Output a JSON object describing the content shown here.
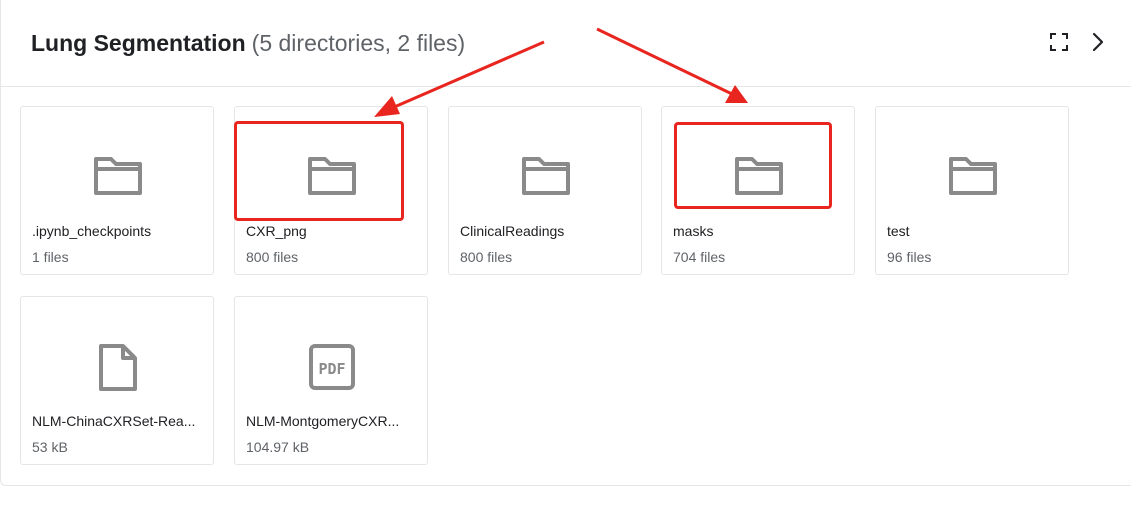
{
  "header": {
    "title": "Lung Segmentation",
    "count_summary": "(5 directories, 2 files)",
    "expand_icon": "fullscreen-icon",
    "next_icon": "chevron-right-icon"
  },
  "items": [
    {
      "name": ".ipynb_checkpoints",
      "meta": "1 files",
      "icon": "folder-icon"
    },
    {
      "name": "CXR_png",
      "meta": "800 files",
      "icon": "folder-icon"
    },
    {
      "name": "ClinicalReadings",
      "meta": "800 files",
      "icon": "folder-icon"
    },
    {
      "name": "masks",
      "meta": "704 files",
      "icon": "folder-icon"
    },
    {
      "name": "test",
      "meta": "96 files",
      "icon": "folder-icon"
    },
    {
      "name": "NLM-ChinaCXRSet-Rea...",
      "meta": "53 kB",
      "icon": "file-icon"
    },
    {
      "name": "NLM-MontgomeryCXR...",
      "meta": "104.97 kB",
      "icon": "pdf-icon"
    }
  ],
  "colors": {
    "icon_gray": "#8a8a8a",
    "annotation_red": "#e8261f",
    "border": "#e6e6e6"
  }
}
